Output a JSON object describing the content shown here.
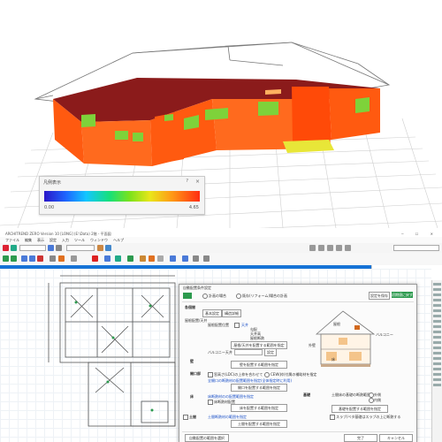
{
  "view3d": {
    "colors": {
      "roof": "#8b1b1b",
      "wall": "#ff5a10",
      "window": "#7ed23a",
      "ground": "#e8e638"
    }
  },
  "legend": {
    "title": "凡例表示",
    "help_icon": "?",
    "close_icon": "×",
    "min": "0.00",
    "max": "4.65"
  },
  "app": {
    "title": "ARCHITREND ZERO Version 10 [LONG] (E:\\Data) 2階 - 平面図",
    "menu": [
      "ファイル",
      "編集",
      "表示",
      "設定",
      "入力",
      "ツール",
      "ウィンドウ",
      "ヘルプ"
    ],
    "accent": "#1673d6"
  },
  "dialog": {
    "title": "自動配置条件設定",
    "radio1": "計画の場合",
    "radio2": "既存(リフォーム)場合の計画",
    "btn_top1": "設定を保存",
    "btn_top2": "初期値に戻す",
    "section1": "各個間",
    "tab1": "基本設定",
    "tab2": "構造詳細",
    "label_kisohaichi": "屋根配置/天井",
    "label_kiso_toggle": "屋根配置位置",
    "opt1": "天井",
    "opt2": "勾配",
    "opt3": "天井高",
    "opt4": "屋根断熱",
    "btn_kiso": "屋根/天井を配置する範囲を指定",
    "label_balcony": "バルコニー天井",
    "btn_balcony": "設定",
    "section_kabe": "壁",
    "btn_kabe": "壁を配置する範囲を指定",
    "section_mado": "開口部",
    "mado_cb": "窓高さ(LDC)の上枠を合わせて",
    "mado_opt": "CEW(枠)付属の補助材を指定",
    "link1": "全開口の断熱材の配置範囲を指定(全体指定時に利用)",
    "btn_mado": "開口を配置する範囲を指定",
    "section_yuka": "床",
    "yuka_link": "床断熱材のの配置範囲を指定",
    "yuka_opt": "床断熱材配置",
    "btn_yuka": "床を配置する範囲を指定",
    "label_doma": "土間",
    "doma_link": "土間断熱材の範囲を指定",
    "btn_doma": "土間を配置する範囲を指定",
    "section_kiso": "基礎",
    "kiso_text": "土間床の基礎の断熱範囲",
    "kiso_opt1": "外側",
    "kiso_opt2": "内側",
    "btn_kiso2": "基礎を配置する範囲を指定",
    "kiso_cb": "スラブ/ベタ基礎はスラブの上に断熱する",
    "illus_labels": [
      "屋根",
      "天井",
      "外壁",
      "床",
      "基礎",
      "バルコニー"
    ],
    "footer_btn1": "自動配置の範囲を選択",
    "footer_ok": "完了",
    "footer_cancel": "キャンセル"
  }
}
